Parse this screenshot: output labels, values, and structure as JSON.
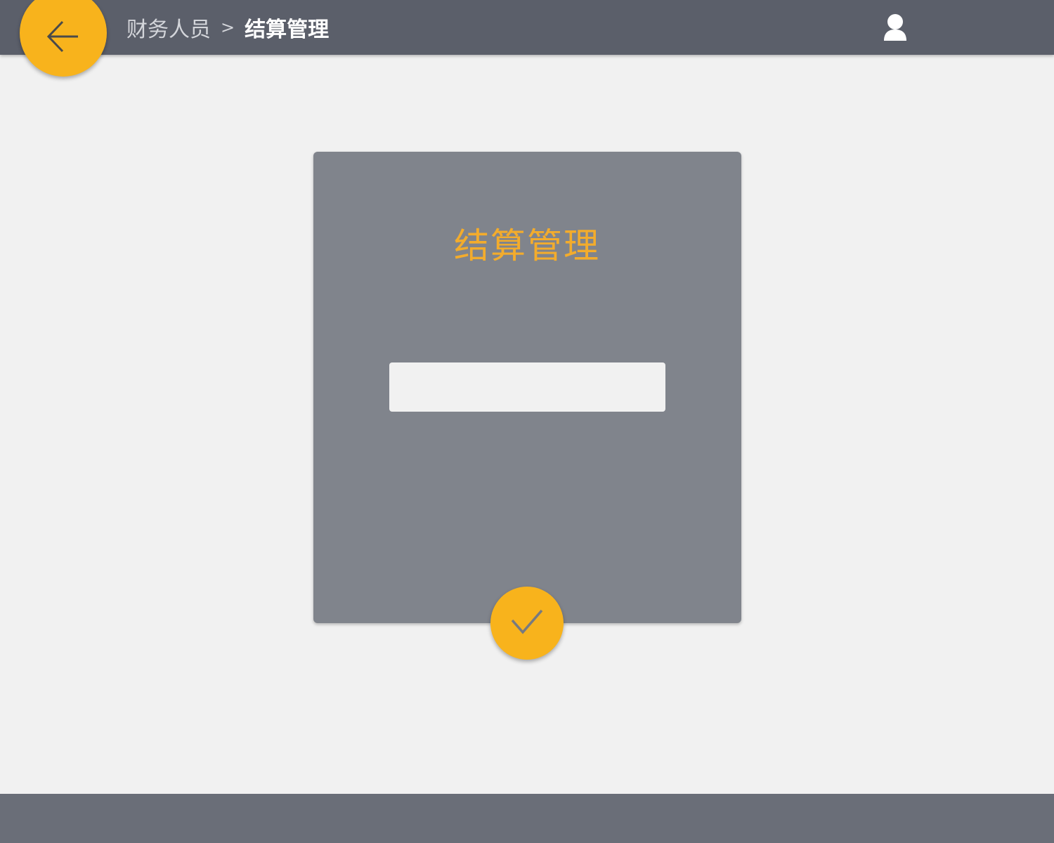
{
  "header": {
    "back_icon": "arrow-left-icon",
    "breadcrumb": {
      "parent": "财务人员",
      "separator": ">",
      "current": "结算管理"
    },
    "user_icon": "user-icon"
  },
  "card": {
    "title": "结算管理",
    "input": {
      "value": "",
      "placeholder": ""
    },
    "confirm_icon": "check-icon"
  },
  "colors": {
    "accent": "#f8b31c",
    "title_text": "#f3ac2c",
    "header_bg": "#5b5f6a",
    "card_bg": "#80848c",
    "footer_bg": "#6a6e78",
    "page_bg": "#f1f1f1"
  }
}
